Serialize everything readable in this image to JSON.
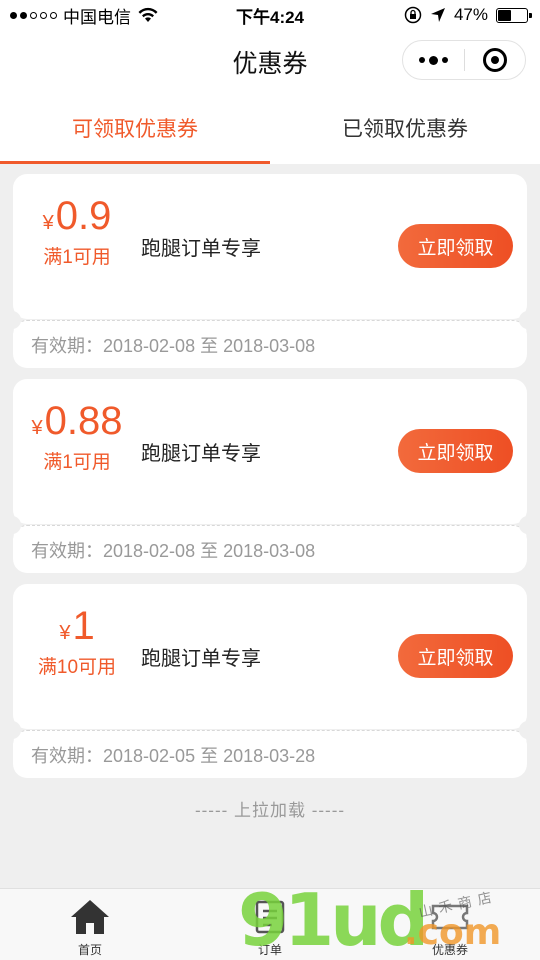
{
  "status_bar": {
    "carrier": "中国电信",
    "time": "下午4:24",
    "battery_text": "47%",
    "battery_level": 0.47
  },
  "nav": {
    "title": "优惠券"
  },
  "tabs": [
    {
      "label": "可领取优惠券",
      "active": true
    },
    {
      "label": "已领取优惠券",
      "active": false
    }
  ],
  "coupons": [
    {
      "currency": "¥",
      "amount": "0.9",
      "condition": "满1可用",
      "name": "跑腿订单专享",
      "button": "立即领取",
      "validity": "有效期：2018-02-08 至 2018-03-08"
    },
    {
      "currency": "¥",
      "amount": "0.88",
      "condition": "满1可用",
      "name": "跑腿订单专享",
      "button": "立即领取",
      "validity": "有效期：2018-02-08 至 2018-03-08"
    },
    {
      "currency": "¥",
      "amount": "1",
      "condition": "满10可用",
      "name": "跑腿订单专享",
      "button": "立即领取",
      "validity": "有效期：2018-02-05 至 2018-03-28"
    }
  ],
  "load_more": "----- 上拉加载 -----",
  "tab_bar": [
    {
      "label": "首页",
      "icon": "home-icon"
    },
    {
      "label": "订单",
      "icon": "order-icon"
    },
    {
      "label": "优惠券",
      "icon": "coupon-icon"
    }
  ],
  "watermark": {
    "brand": "91ud",
    "domain": ".com",
    "text": "山禾商店"
  },
  "colors": {
    "accent": "#f05a2b",
    "background": "#efefef"
  }
}
